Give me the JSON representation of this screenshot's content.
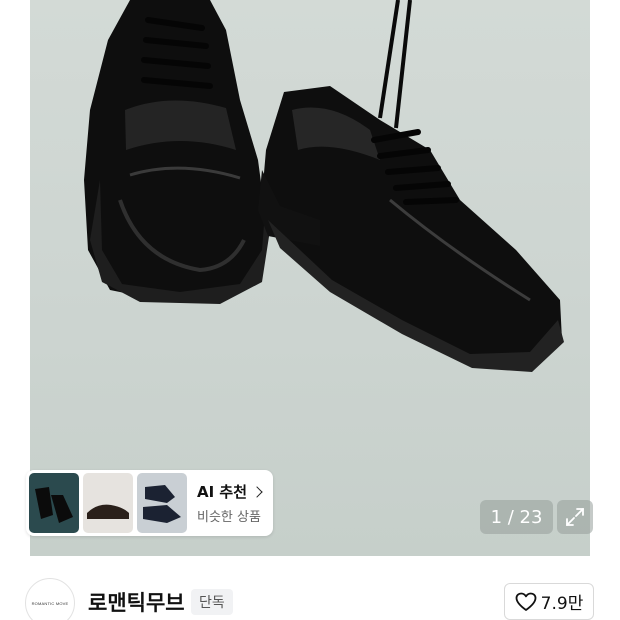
{
  "product_image": {
    "icon": "shoes-photo"
  },
  "ai_recommend": {
    "title": "AI 추천",
    "subtitle": "비슷한 상품",
    "thumbnails": [
      "thumb-shoes-1",
      "thumb-shoes-2",
      "thumb-shoes-3"
    ]
  },
  "gallery": {
    "counter": "1 / 23",
    "expand_icon": "expand-icon"
  },
  "brand": {
    "logo_text": "ROMANTIC MOVE",
    "name": "로맨틱무브",
    "badge": "단독",
    "likes": "7.9만",
    "like_icon": "heart-icon"
  },
  "colors": {
    "photo_bg": "#cfd6d2",
    "overlay": "#969e9b"
  }
}
